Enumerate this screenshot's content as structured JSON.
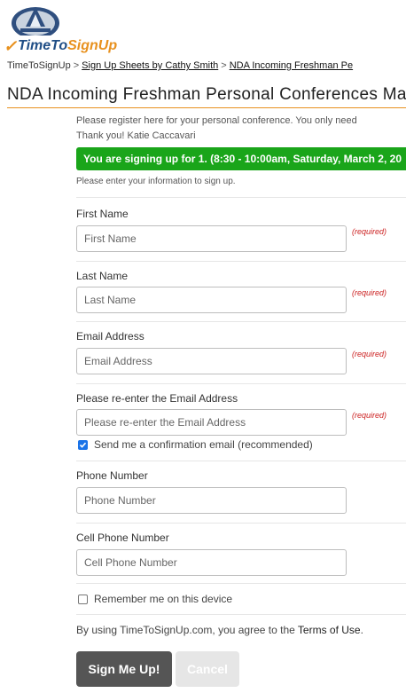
{
  "brand": {
    "name_part1": "TimeTo",
    "name_part2": "SignUp"
  },
  "breadcrumb": {
    "home": "TimeToSignUp",
    "sep1": ">",
    "link1": "Sign Up Sheets by Cathy Smith",
    "sep2": ">",
    "link2": "NDA Incoming Freshman Pe"
  },
  "page_title": "NDA Incoming Freshman Personal Conferences Mar",
  "intro": {
    "line1": "Please register here for your personal conference. You only need",
    "line2": "Thank you! Katie Caccavari"
  },
  "banner": "You are signing up for 1. (8:30 - 10:00am, Saturday, March 2, 20",
  "instructions": "Please enter your information to sign up.",
  "required_label": "(required)",
  "fields": {
    "first_name": {
      "label": "First Name",
      "placeholder": "First Name"
    },
    "last_name": {
      "label": "Last Name",
      "placeholder": "Last Name"
    },
    "email": {
      "label": "Email Address",
      "placeholder": "Email Address"
    },
    "email_confirm": {
      "label": "Please re-enter the Email Address",
      "placeholder": "Please re-enter the Email Address"
    },
    "phone": {
      "label": "Phone Number",
      "placeholder": "Phone Number"
    },
    "cell": {
      "label": "Cell Phone Number",
      "placeholder": "Cell Phone Number"
    }
  },
  "confirm_email_checkbox": {
    "label": "Send me a confirmation email (recommended)",
    "checked": true
  },
  "remember_checkbox": {
    "label": "Remember me on this device",
    "checked": false
  },
  "terms": {
    "prefix": "By using TimeToSignUp.com, you agree to the",
    "link": "Terms of Use",
    "suffix": "."
  },
  "buttons": {
    "submit": "Sign Me Up!",
    "cancel": "Cancel"
  },
  "colors": {
    "accent_orange": "#e8911e",
    "brand_blue": "#1f4e86",
    "banner_green": "#1aa51a",
    "required_red": "#cc2222",
    "checkbox_blue": "#1a73e8"
  }
}
